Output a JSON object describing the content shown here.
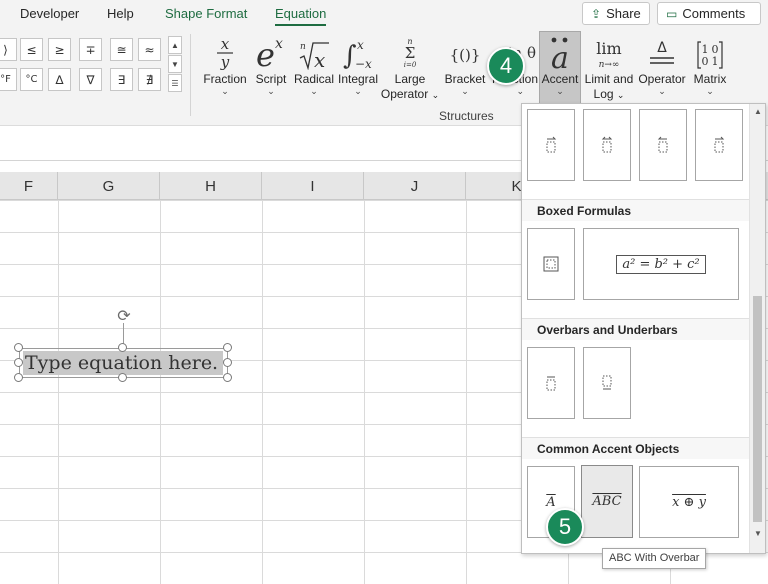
{
  "tabs": [
    {
      "label": "Developer"
    },
    {
      "label": "Help"
    },
    {
      "label": "Shape Format"
    },
    {
      "label": "Equation"
    }
  ],
  "top_buttons": {
    "share": "Share",
    "comments": "Comments"
  },
  "symbols": {
    "row1": [
      "⟩",
      "≤",
      "≥",
      "∓",
      "≅",
      "≈"
    ],
    "row2": [
      "°F",
      "°C",
      "∆",
      "∇",
      "∃",
      "∄"
    ]
  },
  "ribbon": {
    "fraction": {
      "label": "Fraction"
    },
    "script": {
      "label": "Script"
    },
    "radical": {
      "label": "Radical"
    },
    "integral": {
      "label": "Integral"
    },
    "large_operator": {
      "label1": "Large",
      "label2": "Operator"
    },
    "bracket": {
      "label": "Bracket"
    },
    "function": {
      "label": "Function"
    },
    "accent": {
      "label": "Accent"
    },
    "limit_log": {
      "label1": "Limit and",
      "label2": "Log"
    },
    "operator": {
      "label": "Operator"
    },
    "matrix": {
      "label": "Matrix"
    },
    "group_label": "Structures"
  },
  "columns": [
    "F",
    "G",
    "H",
    "I",
    "J",
    "K"
  ],
  "equation_placeholder": "Type equation here.",
  "gallery": {
    "sections": {
      "boxed": "Boxed Formulas",
      "overbars": "Overbars and Underbars",
      "common": "Common Accent Objects"
    },
    "boxed_example": "a² = b² + c²",
    "common_items": [
      "A",
      "ABC",
      "x ⊕ y"
    ]
  },
  "callouts": {
    "step4": "4",
    "step5": "5"
  },
  "tooltip": "ABC With Overbar"
}
